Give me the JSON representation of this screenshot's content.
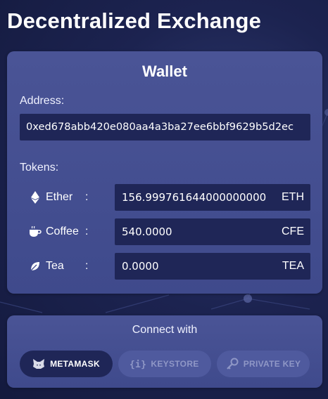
{
  "app": {
    "title": "Decentralized Exchange"
  },
  "wallet": {
    "title": "Wallet",
    "address_label": "Address:",
    "address": "0xed678abb420e080aa4a3ba27ee6bbf9629b5d2ec",
    "tokens_label": "Tokens:",
    "tokens": [
      {
        "name": "Ether",
        "colon": ":",
        "amount": "156.999761644000000000",
        "symbol": "ETH",
        "icon": "ethereum-icon"
      },
      {
        "name": "Coffee",
        "colon": ":",
        "amount": "540.0000",
        "symbol": "CFE",
        "icon": "coffee-cup-icon"
      },
      {
        "name": "Tea",
        "colon": ":",
        "amount": "0.0000",
        "symbol": "TEA",
        "icon": "tea-leaf-icon"
      }
    ]
  },
  "connect": {
    "title": "Connect with",
    "buttons": [
      {
        "label": "METAMASK",
        "icon": "metamask-fox-icon",
        "state": "active"
      },
      {
        "label": "KEYSTORE",
        "icon": "keystore-braces-icon",
        "state": "disabled"
      },
      {
        "label": "PRIVATE KEY",
        "icon": "key-icon",
        "state": "disabled"
      }
    ]
  },
  "colors": {
    "background": "#1c2350",
    "card": "#4a5496",
    "field": "#1f2657",
    "disabled_button": "#4f5a9e",
    "disabled_text": "#8f97c6"
  }
}
